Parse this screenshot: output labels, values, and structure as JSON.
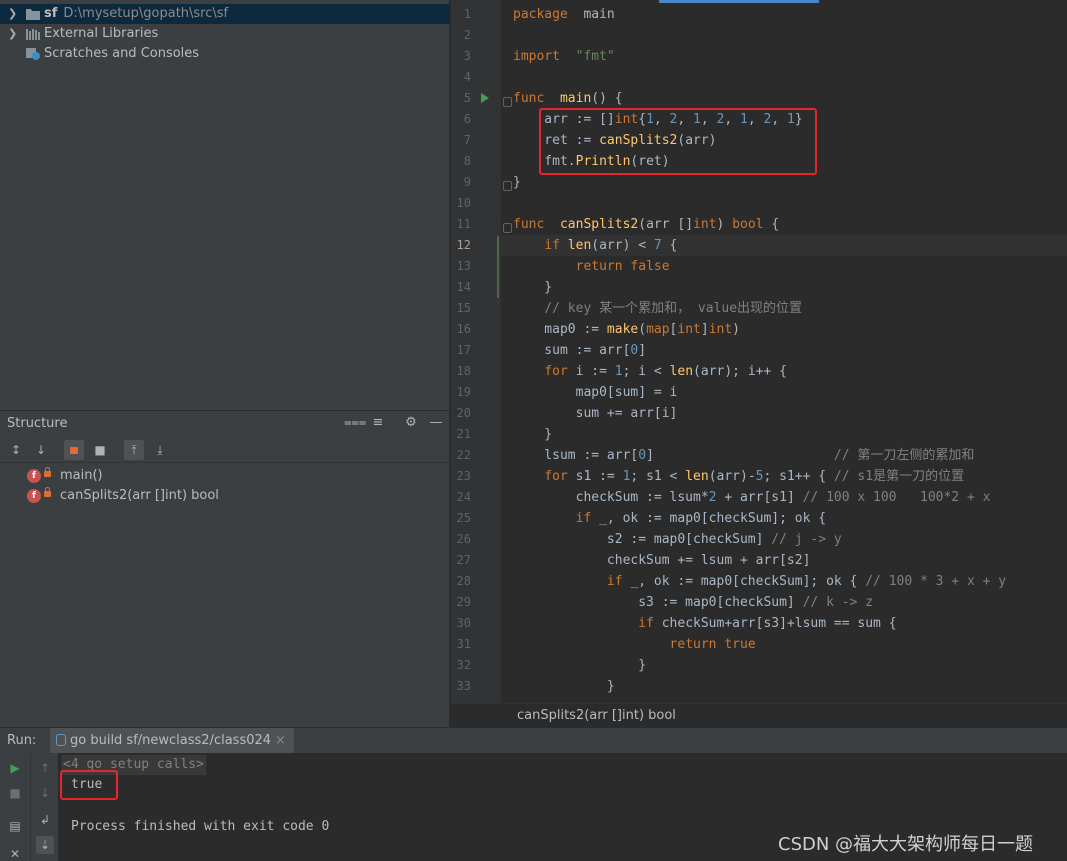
{
  "project": {
    "items": [
      {
        "name": "sf",
        "path": "D:\\mysetup\\gopath\\src\\sf"
      },
      {
        "name": "External Libraries"
      },
      {
        "name": "Scratches and Consoles"
      }
    ]
  },
  "structure": {
    "title": "Structure",
    "items": [
      {
        "badge": "f",
        "label": "main()"
      },
      {
        "badge": "f",
        "label": "canSplits2(arr []int) bool"
      }
    ]
  },
  "editor": {
    "current_line": 12,
    "line_numbers": [
      "1",
      "2",
      "3",
      "4",
      "5",
      "6",
      "7",
      "8",
      "9",
      "10",
      "11",
      "12",
      "13",
      "14",
      "15",
      "16",
      "17",
      "18",
      "19",
      "20",
      "21",
      "22",
      "23",
      "24",
      "25",
      "26",
      "27",
      "28",
      "29",
      "30",
      "31",
      "32",
      "33"
    ],
    "lines": [
      [
        [
          "kw",
          "package"
        ],
        [
          "",
          "  main"
        ]
      ],
      [],
      [
        [
          "kw",
          "import"
        ],
        [
          "",
          "  "
        ],
        [
          "str",
          "\"fmt\""
        ]
      ],
      [],
      [
        [
          "kw",
          "func"
        ],
        [
          "",
          "  "
        ],
        [
          "fn",
          "main"
        ],
        [
          "",
          "() {"
        ]
      ],
      [
        [
          "",
          "    arr := []"
        ],
        [
          "ty",
          "int"
        ],
        [
          "",
          "{"
        ],
        [
          "num",
          "1"
        ],
        [
          "",
          ", "
        ],
        [
          "num",
          "2"
        ],
        [
          "",
          ", "
        ],
        [
          "num",
          "1"
        ],
        [
          "",
          ", "
        ],
        [
          "num",
          "2"
        ],
        [
          "",
          ", "
        ],
        [
          "num",
          "1"
        ],
        [
          "",
          ", "
        ],
        [
          "num",
          "2"
        ],
        [
          "",
          ", "
        ],
        [
          "num",
          "1"
        ],
        [
          "",
          "}"
        ]
      ],
      [
        [
          "",
          "    ret := "
        ],
        [
          "fn",
          "canSplits2"
        ],
        [
          "",
          "(arr)"
        ]
      ],
      [
        [
          "",
          "    fmt."
        ],
        [
          "fn",
          "Println"
        ],
        [
          "",
          "(ret)"
        ]
      ],
      [
        [
          "",
          "}"
        ]
      ],
      [],
      [
        [
          "kw",
          "func"
        ],
        [
          "",
          "  "
        ],
        [
          "fn",
          "canSplits2"
        ],
        [
          "",
          "(arr []"
        ],
        [
          "ty",
          "int"
        ],
        [
          "",
          ") "
        ],
        [
          "ty",
          "bool"
        ],
        [
          "",
          " {"
        ]
      ],
      [
        [
          "",
          "    "
        ],
        [
          "kw",
          "if"
        ],
        [
          "",
          " "
        ],
        [
          "fn",
          "len"
        ],
        [
          "",
          "(arr) < "
        ],
        [
          "num",
          "7"
        ],
        [
          "",
          " {"
        ]
      ],
      [
        [
          "",
          "        "
        ],
        [
          "kw",
          "return"
        ],
        [
          "",
          " "
        ],
        [
          "kw",
          "false"
        ]
      ],
      [
        [
          "",
          "    }"
        ]
      ],
      [
        [
          "",
          "    "
        ],
        [
          "cm",
          "// key 某一个累加和， value出现的位置"
        ]
      ],
      [
        [
          "",
          "    map0 := "
        ],
        [
          "fn",
          "make"
        ],
        [
          "",
          "("
        ],
        [
          "kw",
          "map"
        ],
        [
          "",
          "["
        ],
        [
          "ty",
          "int"
        ],
        [
          "",
          "]"
        ],
        [
          "ty",
          "int"
        ],
        [
          "",
          ")"
        ]
      ],
      [
        [
          "",
          "    sum := arr["
        ],
        [
          "num",
          "0"
        ],
        [
          "",
          "]"
        ]
      ],
      [
        [
          "",
          "    "
        ],
        [
          "kw",
          "for"
        ],
        [
          "",
          " i := "
        ],
        [
          "num",
          "1"
        ],
        [
          "",
          "; i < "
        ],
        [
          "fn",
          "len"
        ],
        [
          "",
          "(arr); i++ {"
        ]
      ],
      [
        [
          "",
          "        map0[sum] = i"
        ]
      ],
      [
        [
          "",
          "        sum += arr[i]"
        ]
      ],
      [
        [
          "",
          "    }"
        ]
      ],
      [
        [
          "",
          "    lsum := arr["
        ],
        [
          "num",
          "0"
        ],
        [
          "",
          "]                       "
        ],
        [
          "cm",
          "// 第一刀左侧的累加和"
        ]
      ],
      [
        [
          "",
          "    "
        ],
        [
          "kw",
          "for"
        ],
        [
          "",
          " s1 := "
        ],
        [
          "num",
          "1"
        ],
        [
          "",
          "; s1 < "
        ],
        [
          "fn",
          "len"
        ],
        [
          "",
          "(arr)-"
        ],
        [
          "num",
          "5"
        ],
        [
          "",
          "; s1++ { "
        ],
        [
          "cm",
          "// s1是第一刀的位置"
        ]
      ],
      [
        [
          "",
          "        checkSum := lsum*"
        ],
        [
          "num",
          "2"
        ],
        [
          "",
          " + arr[s1] "
        ],
        [
          "cm",
          "// 100 x 100   100*2 + x"
        ]
      ],
      [
        [
          "",
          "        "
        ],
        [
          "kw",
          "if"
        ],
        [
          "",
          " _, ok := map0[checkSum]; ok {"
        ]
      ],
      [
        [
          "",
          "            s2 := map0[checkSum] "
        ],
        [
          "cm",
          "// j -> y"
        ]
      ],
      [
        [
          "",
          "            checkSum += lsum + arr[s2]"
        ]
      ],
      [
        [
          "",
          "            "
        ],
        [
          "kw",
          "if"
        ],
        [
          "",
          " _, ok := map0[checkSum]; ok { "
        ],
        [
          "cm",
          "// 100 * 3 + x + y"
        ]
      ],
      [
        [
          "",
          "                s3 := map0[checkSum] "
        ],
        [
          "cm",
          "// k -> z"
        ]
      ],
      [
        [
          "",
          "                "
        ],
        [
          "kw",
          "if"
        ],
        [
          "",
          " checkSum+arr[s3]+lsum == sum {"
        ]
      ],
      [
        [
          "",
          "                    "
        ],
        [
          "kw",
          "return"
        ],
        [
          "",
          " "
        ],
        [
          "kw",
          "true"
        ]
      ],
      [
        [
          "",
          "                }"
        ]
      ],
      [
        [
          "",
          "            }"
        ]
      ]
    ],
    "breadcrumb": "canSplits2(arr []int) bool"
  },
  "run": {
    "label": "Run:",
    "tab_label": "go build sf/newclass2/class024",
    "tab_close": "×",
    "console": {
      "setup_calls": "<4 go setup calls>",
      "output": "true",
      "finish": "Process finished with exit code 0"
    }
  },
  "watermark": "CSDN @福大大架构师每日一题"
}
